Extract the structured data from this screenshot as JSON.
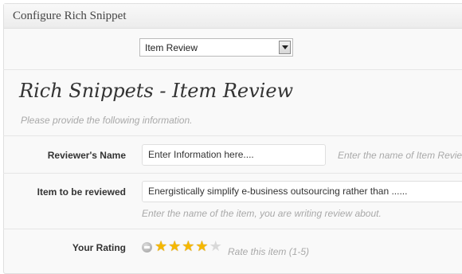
{
  "panel": {
    "title": "Configure Rich Snippet"
  },
  "type_select": {
    "value": "Item Review"
  },
  "section": {
    "heading": "Rich Snippets - Item Review",
    "subtext": "Please provide the following information."
  },
  "fields": {
    "reviewer": {
      "label": "Reviewer's Name",
      "value": "Enter Information here....",
      "hint": "Enter the name of Item Revie"
    },
    "item": {
      "label": "Item to be reviewed",
      "value": "Energistically simplify e-business outsourcing rather than ......",
      "hint": "Enter the name of the item, you are writing review about."
    },
    "rating": {
      "label": "Your Rating",
      "value": 4,
      "max": 5,
      "hint": "Rate this item (1-5)"
    }
  },
  "colors": {
    "star_on": "#f5b800",
    "star_off": "#d9d9d9"
  }
}
